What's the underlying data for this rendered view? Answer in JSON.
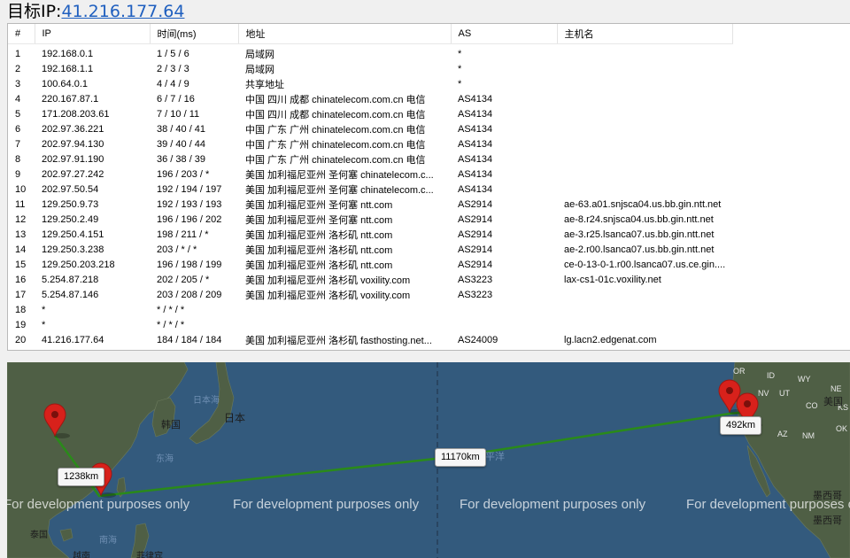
{
  "header": {
    "label": "目标IP:",
    "ip": "41.216.177.64"
  },
  "table": {
    "headers": [
      "#",
      "IP",
      "时间(ms)",
      "地址",
      "AS",
      "主机名"
    ],
    "rows": [
      [
        "1",
        "192.168.0.1",
        "1 / 5 / 6",
        "局域网",
        "*",
        ""
      ],
      [
        "2",
        "192.168.1.1",
        "2 / 3 / 3",
        "局域网",
        "*",
        ""
      ],
      [
        "3",
        "100.64.0.1",
        "4 / 4 / 9",
        "共享地址",
        "*",
        ""
      ],
      [
        "4",
        "220.167.87.1",
        "6 / 7 / 16",
        "中国 四川 成都 chinatelecom.com.cn 电信",
        "AS4134",
        ""
      ],
      [
        "5",
        "171.208.203.61",
        "7 / 10 / 11",
        "中国 四川 成都 chinatelecom.com.cn 电信",
        "AS4134",
        ""
      ],
      [
        "6",
        "202.97.36.221",
        "38 / 40 / 41",
        "中国 广东 广州 chinatelecom.com.cn 电信",
        "AS4134",
        ""
      ],
      [
        "7",
        "202.97.94.130",
        "39 / 40 / 44",
        "中国 广东 广州 chinatelecom.com.cn 电信",
        "AS4134",
        ""
      ],
      [
        "8",
        "202.97.91.190",
        "36 / 38 / 39",
        "中国 广东 广州 chinatelecom.com.cn 电信",
        "AS4134",
        ""
      ],
      [
        "9",
        "202.97.27.242",
        "196 / 203 / *",
        "美国 加利福尼亚州 圣何塞 chinatelecom.c...",
        "AS4134",
        ""
      ],
      [
        "10",
        "202.97.50.54",
        "192 / 194 / 197",
        "美国 加利福尼亚州 圣何塞 chinatelecom.c...",
        "AS4134",
        ""
      ],
      [
        "11",
        "129.250.9.73",
        "192 / 193 / 193",
        "美国 加利福尼亚州 圣何塞 ntt.com",
        "AS2914",
        "ae-63.a01.snjsca04.us.bb.gin.ntt.net"
      ],
      [
        "12",
        "129.250.2.49",
        "196 / 196 / 202",
        "美国 加利福尼亚州 圣何塞 ntt.com",
        "AS2914",
        "ae-8.r24.snjsca04.us.bb.gin.ntt.net"
      ],
      [
        "13",
        "129.250.4.151",
        "198 / 211 / *",
        "美国 加利福尼亚州 洛杉矶 ntt.com",
        "AS2914",
        "ae-3.r25.lsanca07.us.bb.gin.ntt.net"
      ],
      [
        "14",
        "129.250.3.238",
        "203 / * / *",
        "美国 加利福尼亚州 洛杉矶 ntt.com",
        "AS2914",
        "ae-2.r00.lsanca07.us.bb.gin.ntt.net"
      ],
      [
        "15",
        "129.250.203.218",
        "196 / 198 / 199",
        "美国 加利福尼亚州 洛杉矶 ntt.com",
        "AS2914",
        "ce-0-13-0-1.r00.lsanca07.us.ce.gin...."
      ],
      [
        "16",
        "5.254.87.218",
        "202 / 205 / *",
        "美国 加利福尼亚州 洛杉矶 voxility.com",
        "AS3223",
        "lax-cs1-01c.voxility.net"
      ],
      [
        "17",
        "5.254.87.146",
        "203 / 208 / 209",
        "美国 加利福尼亚州 洛杉矶 voxility.com",
        "AS3223",
        ""
      ],
      [
        "18",
        "*",
        "* / * / *",
        "",
        "",
        ""
      ],
      [
        "19",
        "*",
        "* / * / *",
        "",
        "",
        ""
      ],
      [
        "20",
        "41.216.177.64",
        "184 / 184 / 184",
        "美国 加利福尼亚州 洛杉矶 fasthosting.net...",
        "AS24009",
        "lg.lacn2.edgenat.com"
      ]
    ]
  },
  "map": {
    "distances": [
      "1238km",
      "11170km",
      "492km"
    ],
    "watermark": "For development purposes only",
    "places": [
      "日本海",
      "日本",
      "韩国",
      "东海",
      "南海",
      "泰国",
      "越南",
      "菲律宾",
      "平洋",
      "OR",
      "ID",
      "WY",
      "NE",
      "NV",
      "UT",
      "CO",
      "KS",
      "AZ",
      "NM",
      "OK",
      "美国",
      "墨西哥",
      "墨西哥"
    ],
    "route_color": "#2a8a1a"
  }
}
